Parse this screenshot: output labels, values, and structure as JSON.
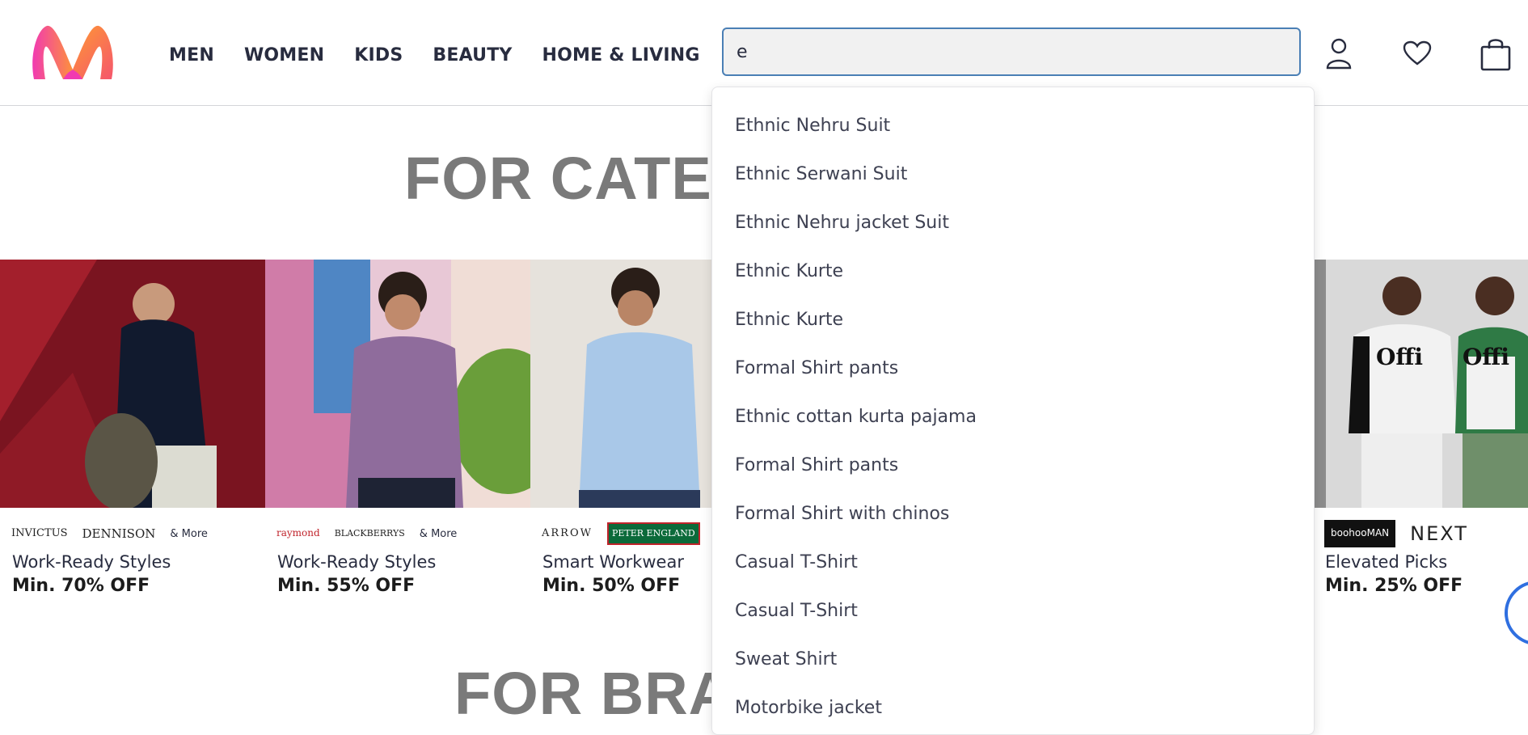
{
  "header": {
    "nav": [
      {
        "label": "MEN"
      },
      {
        "label": "WOMEN"
      },
      {
        "label": "KIDS"
      },
      {
        "label": "BEAUTY"
      },
      {
        "label": "HOME & LIVING"
      }
    ],
    "search": {
      "value": "e"
    },
    "icons": [
      "profile-icon",
      "wishlist-icon",
      "bag-icon"
    ]
  },
  "sections": {
    "categories_title": "FOR CATEG",
    "brands_title": "FOR BRA"
  },
  "banners": [
    {
      "brands": [
        "INVICTUS",
        "DENNISON"
      ],
      "more": "& More",
      "title": "Work-Ready Styles",
      "offer": "Min. 70% OFF"
    },
    {
      "brands": [
        "raymond",
        "BLACKBERRYS"
      ],
      "more": "& More",
      "title": "Work-Ready Styles",
      "offer": "Min. 55% OFF"
    },
    {
      "brands": [
        "ARROW",
        "PETER ENGLAND"
      ],
      "more": "",
      "title": "Smart Workwear",
      "offer": "Min. 50% OFF"
    },
    {
      "brands": [
        "boohooMAN",
        "NEXT"
      ],
      "more": "",
      "title": "Elevated Picks",
      "offer": "Min. 25% OFF"
    }
  ],
  "suggestions": [
    "Ethnic Nehru Suit",
    "Ethnic Serwani Suit",
    "Ethnic Nehru jacket Suit",
    "Ethnic Kurte",
    "Ethnic Kurte",
    "Formal Shirt pants",
    "Ethnic cottan kurta pajama",
    "Formal Shirt pants",
    "Formal Shirt with chinos",
    "Casual T-Shirt",
    "Casual T-Shirt",
    "Sweat Shirt",
    "Motorbike jacket"
  ],
  "colors": {
    "accent": "#ff3f6c",
    "search_border": "#4a7fb5",
    "heading": "#7a7a7a"
  }
}
